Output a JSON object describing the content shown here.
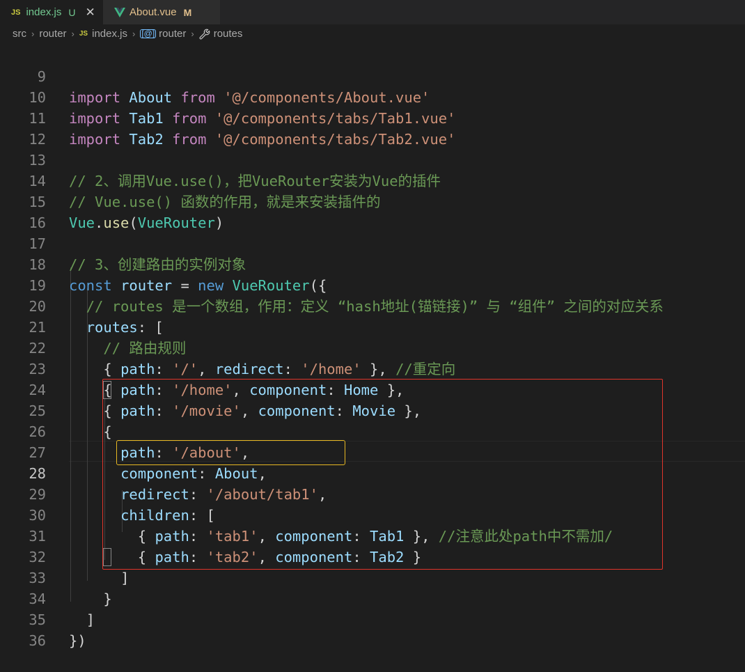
{
  "tabs": [
    {
      "icon": "JS",
      "name": "index.js",
      "status": "U",
      "close": "✕"
    },
    {
      "name": "About.vue",
      "status": "M"
    }
  ],
  "breadcrumb": {
    "items": [
      "src",
      "router",
      "index.js",
      "router",
      "routes"
    ],
    "separator": "›"
  },
  "code": {
    "line_numbers": [
      "9",
      "10",
      "11",
      "12",
      "13",
      "14",
      "15",
      "16",
      "17",
      "18",
      "19",
      "20",
      "21",
      "22",
      "23",
      "24",
      "25",
      "26",
      "27",
      "28",
      "29",
      "30",
      "31",
      "32",
      "33",
      "34",
      "35",
      "36"
    ],
    "current_line": "28",
    "tokens": {
      "import": "import",
      "from": "from",
      "about": "About",
      "tab1": "Tab1",
      "tab2": "Tab2",
      "path_about_vue": "'@/components/About.vue'",
      "path_tab1_vue": "'@/components/tabs/Tab1.vue'",
      "path_tab2_vue": "'@/components/tabs/Tab2.vue'",
      "comment_13": "// 2、调用Vue.use()，把VueRouter安装为Vue的插件",
      "comment_14": "// Vue.use() 函数的作用，就是来安装插件的",
      "vue": "Vue",
      "use": "use",
      "vuerouter": "VueRouter",
      "comment_17": "// 3、创建路由的实例对象",
      "const": "const",
      "router": "router",
      "new": "new",
      "comment_19": "// routes 是一个数组，作用：定义 “hash地址(锚链接)” 与 “组件” 之间的对应关系",
      "routes": "routes",
      "comment_21": "// 路由规则",
      "path": "path",
      "redirect": "redirect",
      "component": "component",
      "children": "children",
      "str_root": "'/'",
      "str_home": "'/home'",
      "str_movie": "'/movie'",
      "str_about": "'/about'",
      "str_about_tab1": "'/about/tab1'",
      "str_tab1": "'tab1'",
      "str_tab2": "'tab2'",
      "home": "Home",
      "movie": "Movie",
      "comment_22": "//重定向",
      "comment_30": "//注意此处path中不需加/"
    }
  },
  "colors": {
    "background": "#1e1e1e",
    "keyword_import": "#c586c0",
    "keyword_decl": "#569cd6",
    "variable": "#9cdcfe",
    "class": "#4ec9b0",
    "function": "#dcdcaa",
    "string": "#ce9178",
    "comment": "#6a9955",
    "annotation_red": "#e0352b",
    "annotation_yellow": "#e8b923"
  }
}
